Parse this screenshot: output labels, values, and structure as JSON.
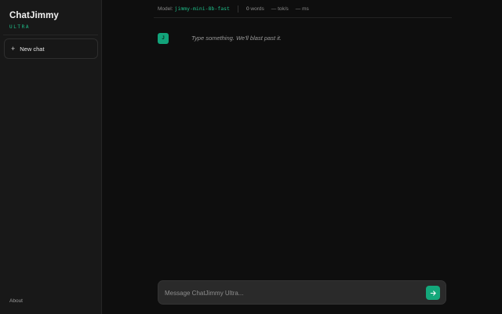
{
  "sidebar": {
    "brand": "ChatJimmy",
    "brand_sub": "ULTRA",
    "new_chat_label": "New chat",
    "new_chat_icon": "plus-icon",
    "about_label": "About"
  },
  "header": {
    "model_label": "Model:",
    "model_name": "jimmy-mini-8b-fast",
    "words_count": "0",
    "words_label": "words",
    "toks_value": "—",
    "toks_unit": "tok/s",
    "ms_value": "—",
    "ms_unit": "ms"
  },
  "conversation": {
    "avatar_letter": "J",
    "message": "Type something. We'll blast past it."
  },
  "composer": {
    "placeholder": "Message ChatJimmy Ultra...",
    "value": "",
    "send_icon": "arrow-right-icon"
  },
  "colors": {
    "accent": "#1fbf8a",
    "background": "#0e0e0e",
    "sidebar": "#181818",
    "composer": "#2a2a2a"
  }
}
